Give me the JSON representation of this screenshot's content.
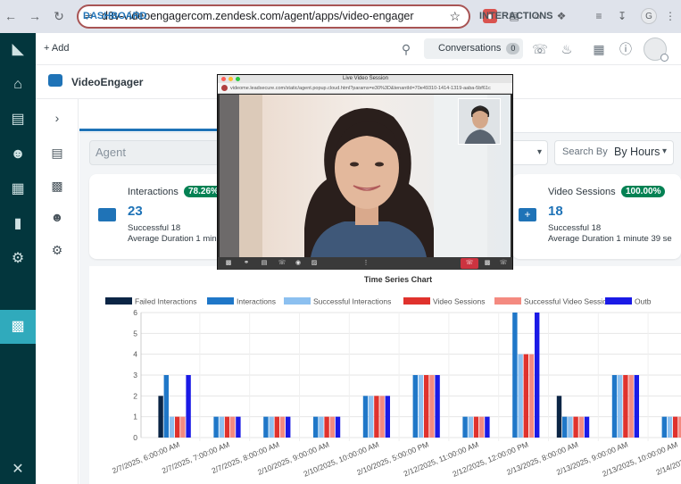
{
  "browser": {
    "url": "d3v-videoengagercom.zendesk.com/agent/apps/video-engager",
    "profile_initial": "G"
  },
  "topbar": {
    "add_label": "+ Add",
    "conversations_label": "Conversations",
    "conversations_count": "0"
  },
  "app": {
    "title": "VideoEngager"
  },
  "tabs": {
    "dashboard": "DASHBOARD",
    "interactions": "INTERACTIONS"
  },
  "filters": {
    "agent_placeholder": "Agent",
    "search_by_label": "Search By",
    "search_by_value": "By Hours"
  },
  "cards": [
    {
      "title": "Interactions",
      "percent": "78.26%",
      "count": "23",
      "successful": "Successful 18",
      "avg_duration": "Average Duration 1 minute"
    },
    {
      "title": "Video Sessions",
      "percent": "100.00%",
      "count": "18",
      "successful": "Successful 18",
      "avg_duration": "Average Duration 1 minute 39 se"
    }
  ],
  "popup": {
    "window_title": "Live Video Session",
    "url": "videome.leadsecure.com/static/agent.popup.cloud.html?params=e30%3D&tenantId=70e49310-1414-1319-aaba-5bf61c"
  },
  "colors": {
    "zendesk_nav": "#03363d",
    "zendesk_active": "#30aabc",
    "brand_blue": "#1f73b7",
    "success_green": "#038153"
  },
  "chart_data": {
    "type": "bar",
    "title": "Time Series Chart",
    "categories": [
      "2/7/2025, 6:00:00 AM",
      "2/7/2025, 7:00:00 AM",
      "2/7/2025, 8:00:00 AM",
      "2/10/2025, 9:00:00 AM",
      "2/10/2025, 10:00:00 AM",
      "2/10/2025, 5:00:00 PM",
      "2/12/2025, 11:00:00 AM",
      "2/12/2025, 12:00:00 PM",
      "2/13/2025, 8:00:00 AM",
      "2/13/2025, 9:00:00 AM",
      "2/13/2025, 10:00:00 AM",
      "2/14/2025, 5:00:00 AM"
    ],
    "tick_labels": [
      "2/7/2025, 6:00:00 AM",
      "2/7/2025, 7:00:00 AM",
      "2/7/2025, 8:00:00 AM",
      "2/10/2025, 9:00:00 AM",
      "2/10/2025, 10:00:00 AM",
      "2/10/2025, 5:00:00 PM",
      "2/12/2025, 11:00:00 AM",
      "2/12/2025, 12:00:00 PM",
      "2/13/2025, 8:00:00 AM",
      "2/13/2025, 9:00:00 AM",
      "2/13/2025, 10:00:00 AM",
      "2/14/2025, 5:00:00 AM"
    ],
    "series": [
      {
        "name": "Failed Interactions",
        "color": "#0b2545",
        "values": [
          2,
          0,
          0,
          0,
          0,
          0,
          0,
          0,
          2,
          0,
          0,
          1
        ]
      },
      {
        "name": "Interactions",
        "color": "#1f77c8",
        "values": [
          3,
          1,
          1,
          1,
          2,
          3,
          1,
          6,
          1,
          3,
          1,
          1
        ]
      },
      {
        "name": "Successful Interactions",
        "color": "#8cc0f0",
        "values": [
          1,
          1,
          1,
          1,
          2,
          3,
          1,
          4,
          1,
          3,
          1,
          0
        ]
      },
      {
        "name": "Video Sessions",
        "color": "#e0322d",
        "values": [
          1,
          1,
          1,
          1,
          2,
          3,
          1,
          4,
          1,
          3,
          1,
          0
        ]
      },
      {
        "name": "Successful Video Sessions",
        "color": "#f48a80",
        "values": [
          1,
          1,
          1,
          1,
          2,
          3,
          1,
          4,
          1,
          3,
          1,
          0
        ]
      },
      {
        "name": "Outb",
        "color": "#1a1ae6",
        "values": [
          3,
          1,
          1,
          1,
          2,
          3,
          1,
          6,
          1,
          3,
          1,
          0
        ]
      }
    ],
    "ylim": [
      0,
      6
    ],
    "yticks": [
      "0",
      "1",
      "2",
      "3",
      "4",
      "5",
      "6"
    ],
    "xlabel": "",
    "ylabel": "",
    "legend": "top"
  }
}
